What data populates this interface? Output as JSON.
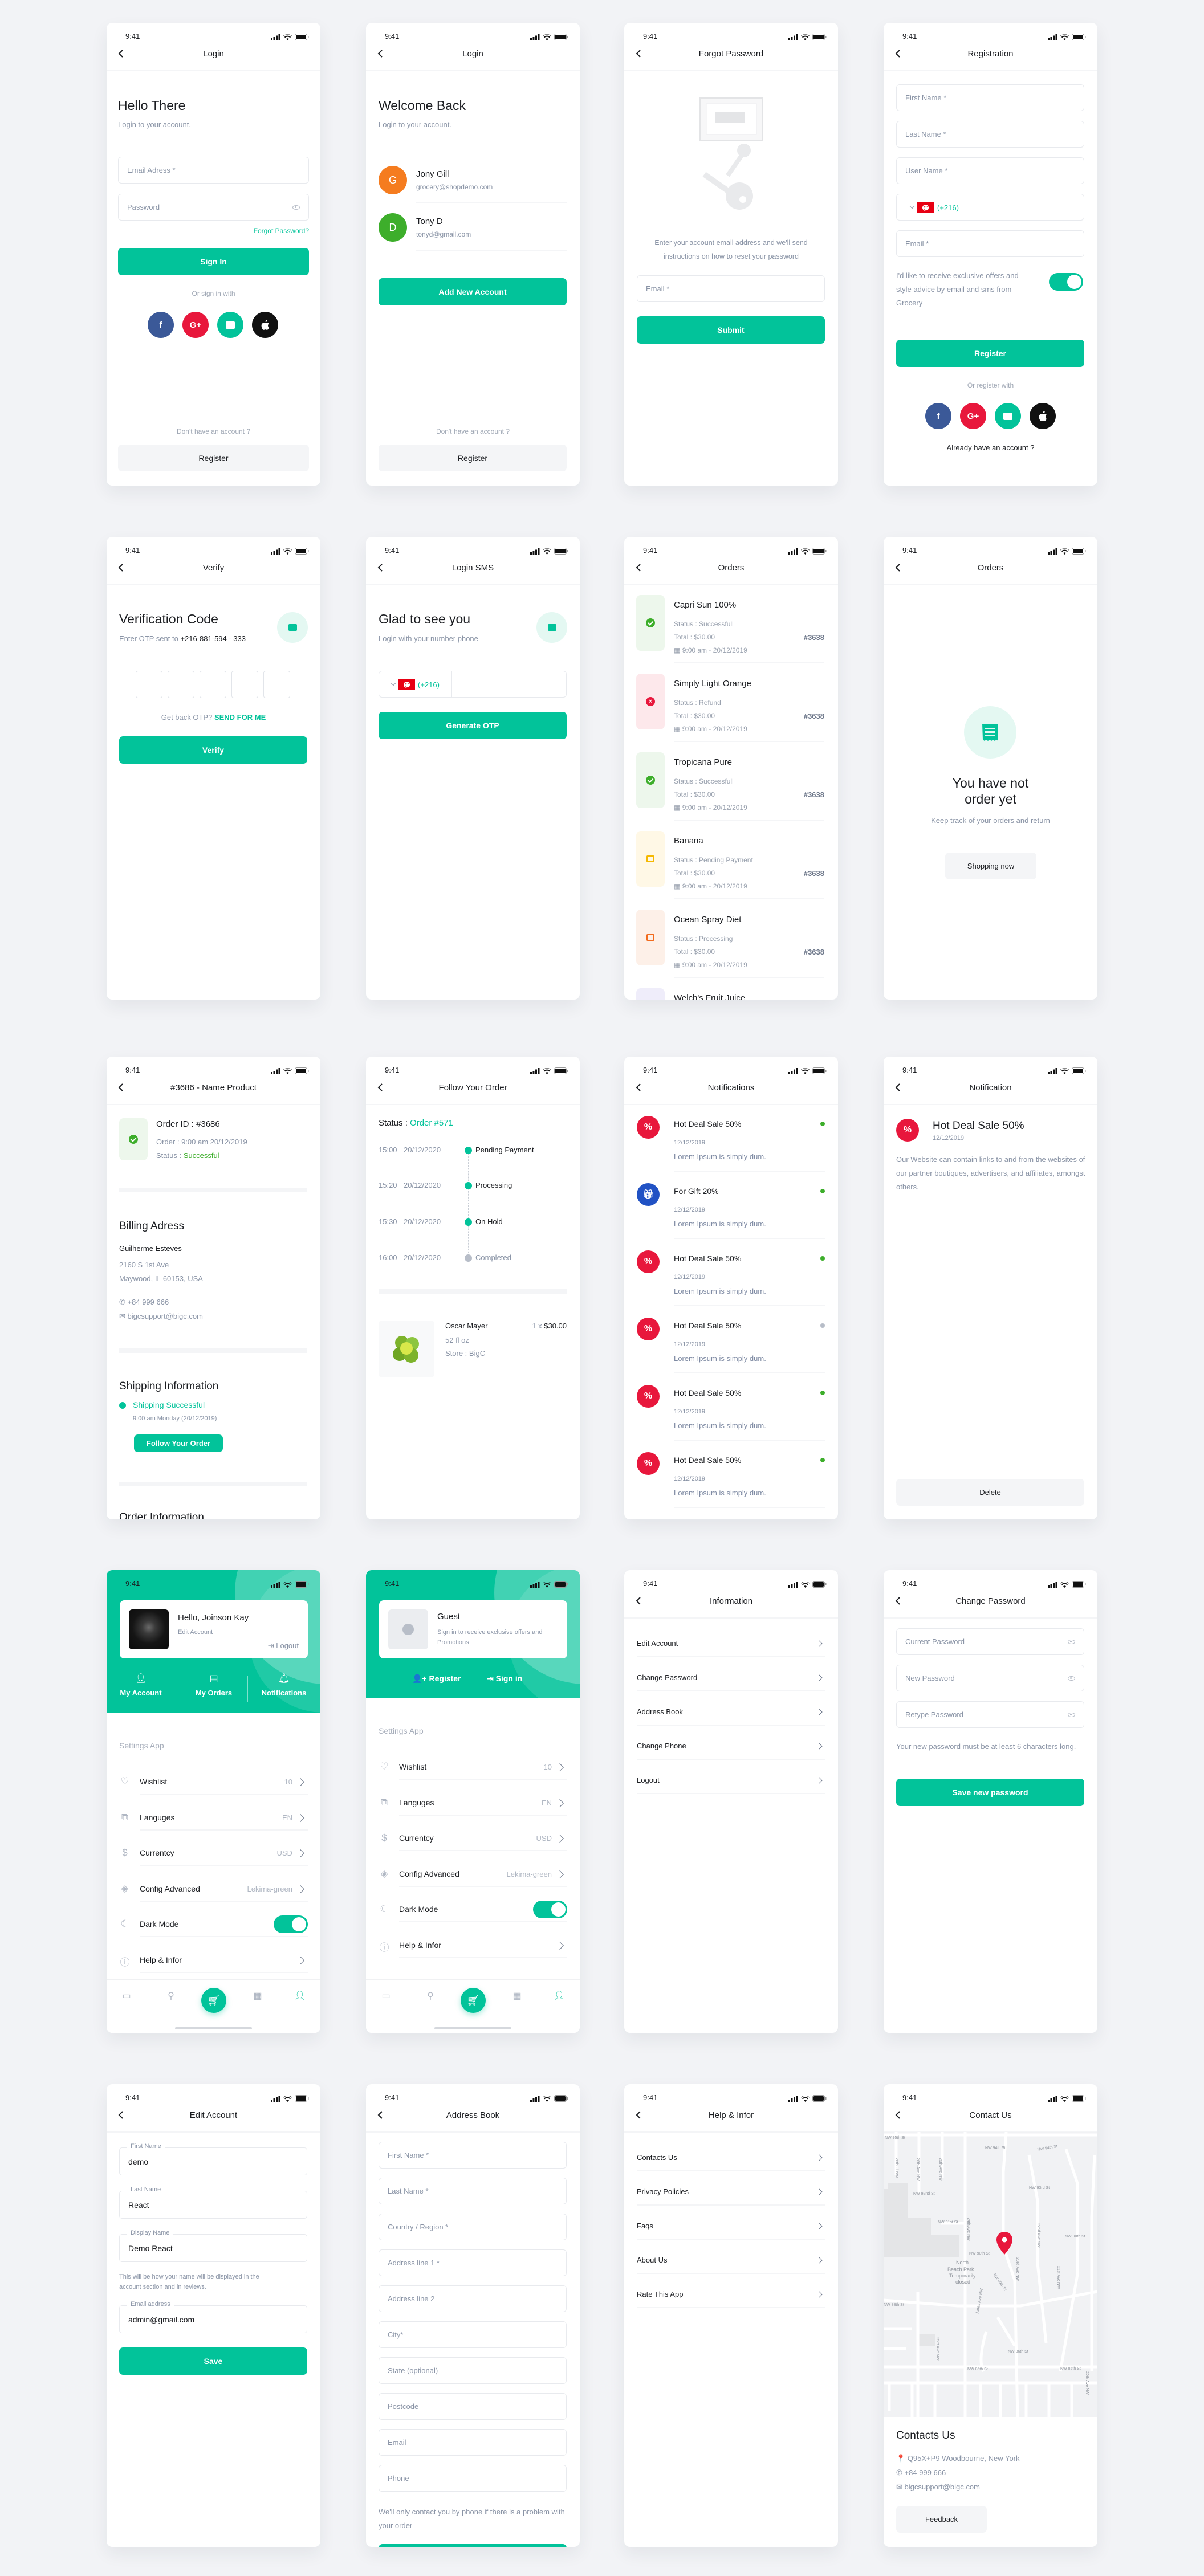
{
  "status_time": "9:41",
  "colors": {
    "accent": "#02C39A",
    "danger": "#E8173C",
    "facebook": "#3B5998",
    "apple": "#111111",
    "text": "#1B1D21",
    "muted": "#8A94A6",
    "background": "#F2F3F6"
  },
  "social_icons": [
    "facebook-icon",
    "google-plus-icon",
    "message-icon",
    "apple-icon"
  ],
  "social_glyphs": [
    "f",
    "G+",
    "",
    ""
  ],
  "screens": {
    "login": {
      "title": "Login",
      "heading": "Hello There",
      "subheading": "Login to your account.",
      "email_placeholder": "Email Adress *",
      "password_placeholder": "Password",
      "forgot": "Forgot Password?",
      "sign_in": "Sign In",
      "or_sign_in": "Or sign in with",
      "no_account": "Don't have an account ?",
      "register": "Register"
    },
    "login_accounts": {
      "title": "Login",
      "heading": "Welcome Back",
      "subheading": "Login to your account.",
      "accounts": [
        {
          "initial": "G",
          "name": "Jony Gill",
          "email": "grocery@shopdemo.com",
          "color": "#F57C1F"
        },
        {
          "initial": "D",
          "name": "Tony D",
          "email": "tonyd@gmail.com",
          "color": "#3DAE2B"
        }
      ],
      "add_account": "Add New Account",
      "no_account": "Don't have an account ?",
      "register": "Register"
    },
    "forgot": {
      "title": "Forgot Password",
      "instructions": "Enter your account email address and we'll send instructions on how to reset your password",
      "email_placeholder": "Email *",
      "submit": "Submit"
    },
    "registration": {
      "title": "Registration",
      "fields": [
        "First Name *",
        "Last Name *",
        "User Name *"
      ],
      "country_code": "(+216)",
      "email_placeholder": "Email *",
      "consent": "I'd like to receive exclusive offers and style advice by email and sms from Grocery",
      "consent_on": true,
      "register": "Register",
      "or_register": "Or register with",
      "already": "Already have an account ?"
    },
    "verify": {
      "title": "Verify",
      "heading": "Verification Code",
      "sent_to": "Enter OTP sent to",
      "phone": "+216-881-594 - 333",
      "get_back": "Get back OTP?",
      "send_for_me": "SEND FOR ME",
      "verify": "Verify"
    },
    "login_sms": {
      "title": "Login SMS",
      "heading": "Glad to see you",
      "subheading": "Login with your number phone",
      "country_code": "(+216)",
      "generate": "Generate OTP"
    },
    "orders": {
      "title": "Orders",
      "status_label": "Status",
      "total_label": "Total",
      "items": [
        {
          "name": "Capri Sun 100%",
          "status": "Successfull",
          "total": "$30.00",
          "time": "9:00 am",
          "date": "20/12/2019",
          "id": "#3638",
          "icon": "check-badge-icon",
          "bg": "#EDF7EC",
          "color": "#3DAE2B"
        },
        {
          "name": "Simply Light Orange",
          "status": "Refund",
          "total": "$30.00",
          "time": "9:00 am",
          "date": "20/12/2019",
          "id": "#3638",
          "icon": "close-circle-icon",
          "bg": "#FDE8EB",
          "color": "#E8173C"
        },
        {
          "name": "Tropicana Pure",
          "status": "Successfull",
          "total": "$30.00",
          "time": "9:00 am",
          "date": "20/12/2019",
          "id": "#3638",
          "icon": "check-badge-icon",
          "bg": "#EDF7EC",
          "color": "#3DAE2B"
        },
        {
          "name": "Banana",
          "status": "Pending Payment",
          "total": "$30.00",
          "time": "9:00 am",
          "date": "20/12/2019",
          "id": "#3638",
          "icon": "payment-icon",
          "bg": "#FFF8E6",
          "color": "#F5B800"
        },
        {
          "name": "Ocean Spray Diet",
          "status": "Processing",
          "total": "$30.00",
          "time": "9:00 am",
          "date": "20/12/2019",
          "id": "#3638",
          "icon": "processing-icon",
          "bg": "#FDF0E8",
          "color": "#F26B1D"
        },
        {
          "name": "Welch's Fruit Juice",
          "bg": "#EFEDFA",
          "icon": "order-icon",
          "color": "#7B6CD9"
        }
      ]
    },
    "orders_empty": {
      "title": "Orders",
      "heading": "You have not order yet",
      "subheading": "Keep track of your orders and return",
      "shopping": "Shopping now"
    },
    "order_detail": {
      "title": "#3686 - Name Product",
      "order_id": "Order ID : #3686",
      "order_line": "Order : 9:00 am   20/12/2019",
      "status_label": "Status :",
      "status": "Successful",
      "billing_title": "Billing Adress",
      "billing_name": "Guilherme Esteves",
      "address_1": "2160 S 1st Ave",
      "address_2": "Maywood, IL 60153, USA",
      "phone": "+84 999 666",
      "email": "bigcsupport@bigc.com",
      "shipping_title": "Shipping Information",
      "shipping_status": "Shipping Successful",
      "shipping_time": "9:00 am   Monday (20/12/2019)",
      "follow": "Follow Your Order",
      "order_info_title": "Order Information"
    },
    "follow": {
      "title": "Follow Your Order",
      "status_label": "Status :",
      "order": "Order #571",
      "steps": [
        {
          "time": "15:00",
          "date": "20/12/2020",
          "label": "Pending Payment",
          "done": true
        },
        {
          "time": "15:20",
          "date": "20/12/2020",
          "label": "Processing",
          "done": true
        },
        {
          "time": "15:30",
          "date": "20/12/2020",
          "label": "On Hold",
          "done": true
        },
        {
          "time": "16:00",
          "date": "20/12/2020",
          "label": "Completed",
          "done": false
        }
      ],
      "product": {
        "name": "Oscar Mayer",
        "size": "52 fl oz",
        "store": "Store : BigC",
        "qty": "1 x",
        "price": "$30.00"
      }
    },
    "notifications": {
      "title": "Notifications",
      "items": [
        {
          "title": "Hot Deal Sale 50%",
          "date": "12/12/2019",
          "text": "Lorem Ipsum is simply dum.",
          "icon": "percent-icon",
          "unread": true
        },
        {
          "title": "For Gift 20%",
          "date": "12/12/2019",
          "text": "Lorem Ipsum is simply dum.",
          "icon": "gift-icon",
          "unread": true
        },
        {
          "title": "Hot Deal Sale 50%",
          "date": "12/12/2019",
          "text": "Lorem Ipsum is simply dum.",
          "icon": "percent-icon",
          "unread": true
        },
        {
          "title": "Hot Deal Sale 50%",
          "date": "12/12/2019",
          "text": "Lorem Ipsum is simply dum.",
          "icon": "percent-icon",
          "unread": false
        },
        {
          "title": "Hot Deal Sale 50%",
          "date": "12/12/2019",
          "text": "Lorem Ipsum is simply dum.",
          "icon": "percent-icon",
          "unread": true
        },
        {
          "title": "Hot Deal Sale 50%",
          "date": "12/12/2019",
          "text": "Lorem Ipsum is simply dum.",
          "icon": "percent-icon",
          "unread": true
        }
      ]
    },
    "notification": {
      "title": "Notification",
      "heading": "Hot Deal Sale 50%",
      "date": "12/12/2019",
      "body": "Our Website can contain links to and from the websites of our partner boutiques, advertisers, and affiliates, amongst others.",
      "delete": "Delete"
    },
    "profile": {
      "greeting": "Hello, Joinson Kay",
      "edit": "Edit Account",
      "logout": "Logout",
      "tabs": [
        "My Account",
        "My Orders",
        "Notifications"
      ]
    },
    "guest": {
      "name": "Guest",
      "message": "Sign in to receive exclusive offers and Promotions",
      "register": "Register",
      "sign_in": "Sign in"
    },
    "settings": {
      "title": "Settings App",
      "rows": [
        {
          "icon": "heart-icon",
          "label": "Wishlist",
          "value": "10",
          "type": "chevron"
        },
        {
          "icon": "translate-icon",
          "label": "Languges",
          "value": "EN",
          "type": "chevron"
        },
        {
          "icon": "currency-icon",
          "label": "Currentcy",
          "value": "USD",
          "type": "chevron"
        },
        {
          "icon": "layers-icon",
          "label": "Config Advanced",
          "value": "Lekima-green",
          "type": "chevron"
        },
        {
          "icon": "dark-mode-icon",
          "label": "Dark Mode",
          "value": "",
          "type": "toggle",
          "on": true
        },
        {
          "icon": "info-icon",
          "label": "Help & Infor",
          "value": "",
          "type": "chevron"
        }
      ]
    },
    "bottom_nav": {
      "items": [
        "Home",
        "Discover",
        "",
        "Shop",
        "Profile"
      ],
      "active": "Profile"
    },
    "information": {
      "title": "Information",
      "rows": [
        "Edit Account",
        "Change Password",
        "Address Book",
        "Change Phone",
        "Logout"
      ]
    },
    "change_password": {
      "title": "Change Password",
      "fields": [
        "Current Password",
        "New Password",
        "Retype Password"
      ],
      "note": "Your new password must be at least 6 characters long.",
      "save": "Save new password"
    },
    "edit_account": {
      "title": "Edit Account",
      "first_name_label": "First Name",
      "first_name": "demo",
      "last_name_label": "Last Name",
      "last_name": "React",
      "display_label": "Display Name",
      "display_name": "Demo React",
      "help": "This will be how your name will be displayed in the account section and in reviews.",
      "email_label": "Email address",
      "email": "admin@gmail.com",
      "save": "Save"
    },
    "address_book": {
      "title": "Address Book",
      "fields": [
        "First Name *",
        "Last Name *",
        "Country / Region *",
        "Address line 1 *",
        "Address line 2",
        "City*",
        "State (optional)",
        "Postcode",
        "Email",
        "Phone"
      ],
      "note": "We'll only contact you by phone if there is a problem with your order"
    },
    "help": {
      "title": "Help & Infor",
      "rows": [
        "Contacts Us",
        "Privacy Policies",
        "Faqs",
        "About Us",
        "Rate This App"
      ]
    },
    "contact": {
      "title": "Contact Us",
      "heading": "Contacts Us",
      "address": "Q95X+P9 Woodbourne, New York",
      "phone": "+84 999 666",
      "email": "bigcsupport@bigc.com",
      "feedback": "Feedback",
      "map_labels": [
        "NW 95th St",
        "26th Pl NW",
        "26th Ave NW",
        "25th Ave NW",
        "NW 94th St",
        "NW 94th St",
        "NW 93rd St",
        "NW 92nd St",
        "NW 91st St",
        "24th Ave NW",
        "NW 90th St",
        "NW 90th St",
        "22nd Ave NW",
        "21st Ave NW",
        "North",
        "Beach Park",
        "Temporarily",
        "closed",
        "NW 89th Pl",
        "23rd Ave NW",
        "NW 88th St",
        "Jones Ave NW",
        "25th Ave NW",
        "NW 86th St",
        "NW 85th St",
        "NW 85th St",
        "20th Ave NW"
      ]
    }
  }
}
